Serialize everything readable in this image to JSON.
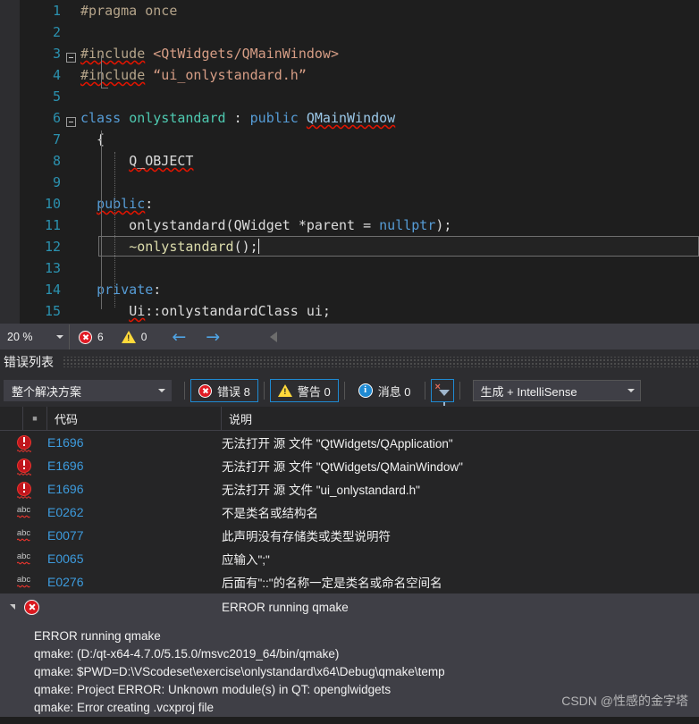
{
  "editor": {
    "lines": [
      {
        "num": "1",
        "text": "#pragma once"
      },
      {
        "num": "2",
        "text": ""
      },
      {
        "num": "3",
        "text": "#include <QtWidgets/QMainWindow>"
      },
      {
        "num": "4",
        "text": "#include \"ui_onlystandard.h\""
      },
      {
        "num": "5",
        "text": ""
      },
      {
        "num": "6",
        "text": "class onlystandard : public QMainWindow"
      },
      {
        "num": "7",
        "text": "{"
      },
      {
        "num": "8",
        "text": "    Q_OBJECT"
      },
      {
        "num": "9",
        "text": ""
      },
      {
        "num": "10",
        "text": "public:"
      },
      {
        "num": "11",
        "text": "    onlystandard(QWidget *parent = nullptr);"
      },
      {
        "num": "12",
        "text": "    ~onlystandard();"
      },
      {
        "num": "13",
        "text": ""
      },
      {
        "num": "14",
        "text": "private:"
      },
      {
        "num": "15",
        "text": "    Ui::onlystandardClass ui;"
      }
    ]
  },
  "statusbar": {
    "zoom_level": "20 %",
    "error_count": "6",
    "warning_count": "0",
    "back_arrow": "←",
    "forward_arrow": "→"
  },
  "error_list": {
    "panel_title": "错误列表",
    "scope_filter": "整个解决方案",
    "errors_label": "错误 8",
    "warnings_label": "警告 0",
    "messages_label": "消息 0",
    "build_filter": "生成 + IntelliSense",
    "columns": {
      "code": "代码",
      "description": "说明"
    },
    "rows": [
      {
        "icon": "error-icon",
        "code": "E1696",
        "description": "无法打开 源 文件 \"QtWidgets/QApplication\""
      },
      {
        "icon": "error-icon",
        "code": "E1696",
        "description": "无法打开 源 文件 \"QtWidgets/QMainWindow\""
      },
      {
        "icon": "error-icon",
        "code": "E1696",
        "description": "无法打开 源 文件 \"ui_onlystandard.h\""
      },
      {
        "icon": "abc-icon",
        "code": "E0262",
        "description": "不是类名或结构名"
      },
      {
        "icon": "abc-icon",
        "code": "E0077",
        "description": "此声明没有存储类或类型说明符"
      },
      {
        "icon": "abc-icon",
        "code": "E0065",
        "description": "应输入\";\""
      },
      {
        "icon": "abc-icon",
        "code": "E0276",
        "description": "后面有\"::\"的名称一定是类名或命名空间名"
      }
    ],
    "selected_row": {
      "icon": "error-icon",
      "description": "ERROR running qmake"
    }
  },
  "detail_output": {
    "lines": [
      "ERROR running qmake",
      "qmake: (D:/qt-x64-4.7.0/5.15.0/msvc2019_64/bin/qmake)",
      "qmake: $PWD=D:\\VScodeset\\exercise\\onlystandard\\x64\\Debug\\qmake\\temp",
      "qmake: Project ERROR: Unknown module(s) in QT: openglwidgets",
      "qmake: Error creating .vcxproj file"
    ],
    "watermark": "CSDN @性感的金字塔"
  },
  "colors": {
    "editor_bg": "#1e1e1e",
    "panel_bg": "#252526",
    "chrome_bg": "#2d2d30",
    "toolbar_bg": "#3f3f46",
    "accent_blue": "#1f8ad2",
    "link_blue": "#3d9bdd",
    "error_red": "#c0161d",
    "warning_yellow": "#ffd93b",
    "line_number": "#2b91af"
  }
}
